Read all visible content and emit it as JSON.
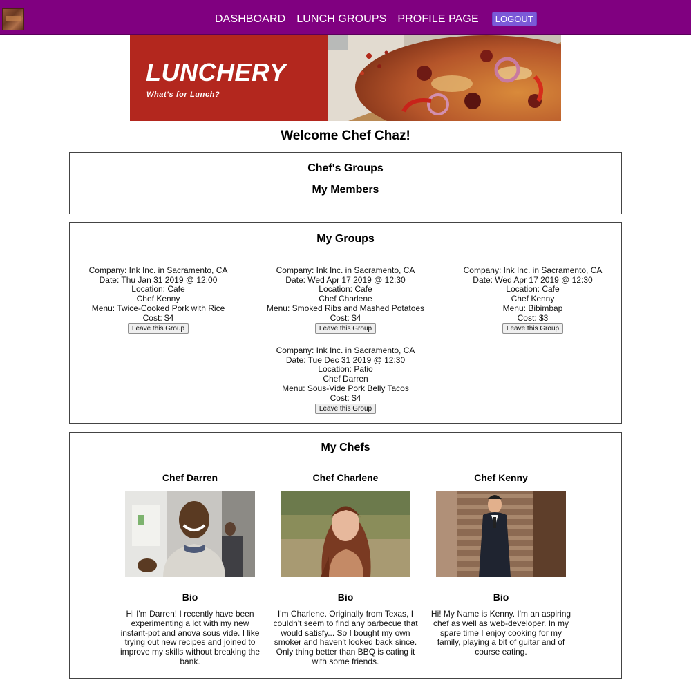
{
  "nav": {
    "logo_icon": "lunchery-logo-thumb",
    "links": [
      "DASHBOARD",
      "LUNCH GROUPS",
      "PROFILE PAGE"
    ],
    "logout": "LOGOUT",
    "bg_color": "#800080",
    "logout_color": "#7b5ad8"
  },
  "banner": {
    "title": "LUNCHERY",
    "subtitle": "What's for Lunch?",
    "bg_color": "#b3271e",
    "photo": "pizza-photo"
  },
  "welcome": "Welcome Chef Chaz!",
  "chef_groups_panel": {
    "heading1": "Chef's Groups",
    "heading2": "My Members"
  },
  "my_groups": {
    "heading": "My Groups",
    "leave_label": "Leave this Group",
    "groups": [
      {
        "company": "Company: Ink Inc. in Sacramento, CA",
        "date": "Date: Thu Jan 31 2019 @ 12:00",
        "location": "Location: Cafe",
        "chef": "Chef Kenny",
        "menu": "Menu: Twice-Cooked Pork with Rice",
        "cost": "Cost: $4"
      },
      {
        "company": "Company: Ink Inc. in Sacramento, CA",
        "date": "Date: Wed Apr 17 2019 @ 12:30",
        "location": "Location: Cafe",
        "chef": "Chef Charlene",
        "menu": "Menu: Smoked Ribs and Mashed Potatoes",
        "cost": "Cost: $4"
      },
      {
        "company": "Company: Ink Inc. in Sacramento, CA",
        "date": "Date: Wed Apr 17 2019 @ 12:30",
        "location": "Location: Cafe",
        "chef": "Chef Kenny",
        "menu": "Menu: Bibimbap",
        "cost": "Cost: $3"
      },
      {
        "company": "Company: Ink Inc. in Sacramento, CA",
        "date": "Date: Tue Dec 31 2019 @ 12:30",
        "location": "Location: Patio",
        "chef": "Chef Darren",
        "menu": "Menu: Sous-Vide Pork Belly Tacos",
        "cost": "Cost: $4"
      }
    ]
  },
  "my_chefs": {
    "heading": "My Chefs",
    "bio_label": "Bio",
    "chefs": [
      {
        "name": "Chef Darren",
        "photo": "chef-darren-photo",
        "bio": "Hi I'm Darren! I recently have been experimenting a lot with my new instant-pot and anova sous vide. I like trying out new recipes and joined to improve my skills without breaking the bank."
      },
      {
        "name": "Chef Charlene",
        "photo": "chef-charlene-photo",
        "bio": "I'm Charlene. Originally from Texas, I couldn't seem to find any barbecue that would satisfy... So I bought my own smoker and haven't looked back since. Only thing better than BBQ is eating it with some friends."
      },
      {
        "name": "Chef Kenny",
        "photo": "chef-kenny-photo",
        "bio": "Hi! My Name is Kenny. I'm an aspiring chef as well as web-developer. In my spare time I enjoy cooking for my family, playing a bit of guitar and of course eating."
      }
    ]
  }
}
